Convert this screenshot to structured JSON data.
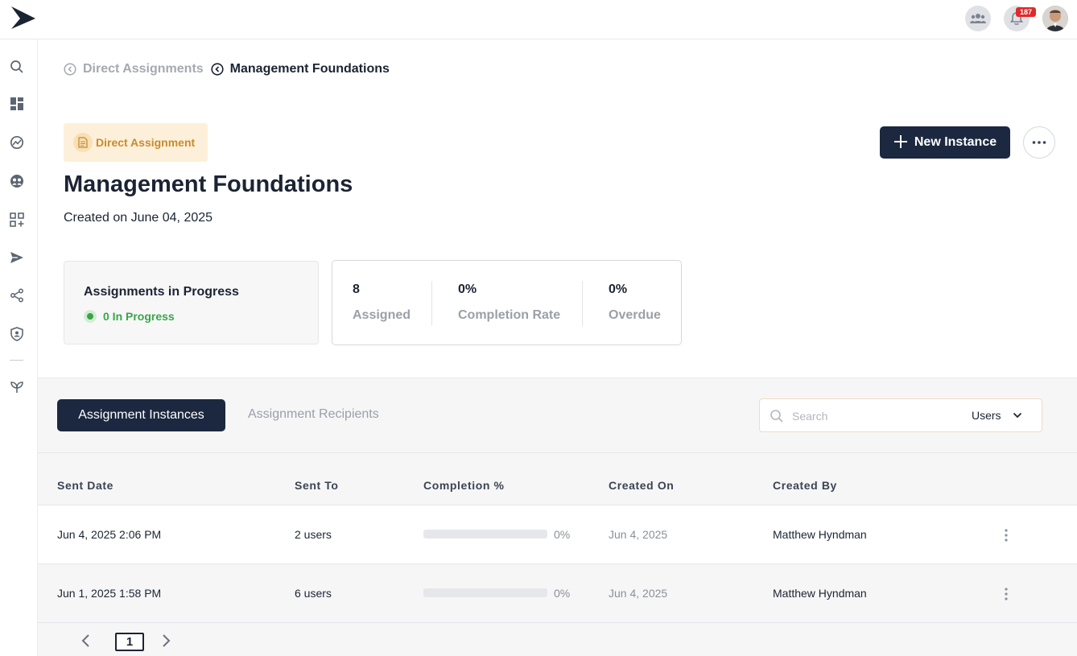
{
  "header": {
    "notification_count": "187"
  },
  "breadcrumb": {
    "parent": "Direct Assignments",
    "current": "Management Foundations"
  },
  "assignment": {
    "type_label": "Direct Assignment",
    "title": "Management Foundations",
    "created": "Created on June 04, 2025",
    "new_instance_label": "New Instance"
  },
  "progress_card": {
    "heading": "Assignments in Progress",
    "status": "0 In Progress"
  },
  "stats": [
    {
      "value": "8",
      "label": "Assigned"
    },
    {
      "value": "0%",
      "label": "Completion Rate"
    },
    {
      "value": "0%",
      "label": "Overdue"
    }
  ],
  "tabs": {
    "active": "Assignment Instances",
    "inactive": "Assignment Recipients"
  },
  "search": {
    "placeholder": "Search",
    "filter_value": "Users"
  },
  "table": {
    "columns": [
      "Sent Date",
      "Sent To",
      "Completion %",
      "Created On",
      "Created By"
    ],
    "rows": [
      {
        "sent_date": "Jun 4, 2025 2:06 PM",
        "sent_to": "2 users",
        "completion": 0,
        "completion_label": "0%",
        "created_on": "Jun 4, 2025",
        "created_by": "Matthew Hyndman"
      },
      {
        "sent_date": "Jun 1, 2025 1:58 PM",
        "sent_to": "6 users",
        "completion": 0,
        "completion_label": "0%",
        "created_on": "Jun 4, 2025",
        "created_by": "Matthew Hyndman"
      }
    ]
  },
  "pagination": {
    "current_page": "1"
  },
  "colors": {
    "primary": "#1b2840",
    "success": "#3aa548",
    "badge_bg": "#fdf0da",
    "badge_text": "#c98b2c",
    "notification": "#e02a2a"
  },
  "icons": {
    "sidebar": [
      "search-icon",
      "dashboard-icon",
      "analytics-icon",
      "people-icon",
      "apps-add-icon",
      "send-icon",
      "share-icon",
      "shield-icon",
      "plant-icon"
    ]
  }
}
